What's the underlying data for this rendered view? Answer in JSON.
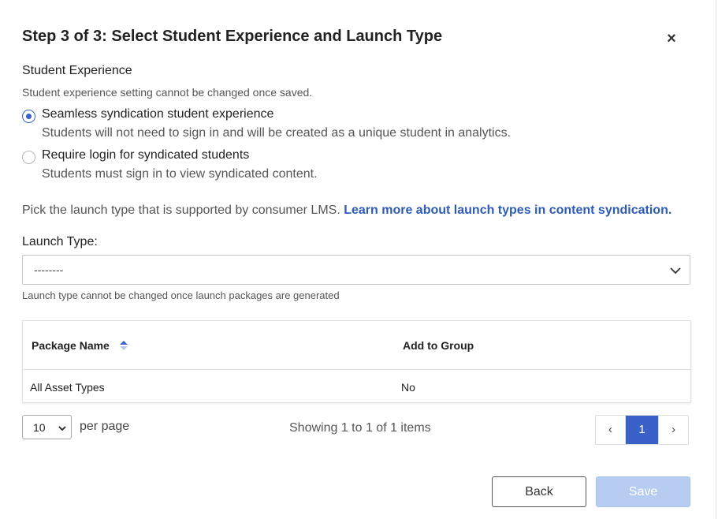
{
  "dialog": {
    "title": "Step 3 of 3: Select Student Experience and Launch Type",
    "close_label": "×"
  },
  "student_experience": {
    "heading": "Student Experience",
    "note": "Student experience setting cannot be changed once saved.",
    "options": [
      {
        "label": "Seamless syndication student experience",
        "description": "Students will not need to sign in and will be created as a unique student in analytics.",
        "selected": true
      },
      {
        "label": "Require login for syndicated students",
        "description": "Students must sign in to view syndicated content.",
        "selected": false
      }
    ]
  },
  "launch": {
    "intro": "Pick the launch type that is supported by consumer LMS.",
    "learn_more_link": "Learn more about launch types in content syndication.",
    "label": "Launch Type:",
    "selected_value": "--------",
    "help": "Launch type cannot be changed once launch packages are generated"
  },
  "table": {
    "columns": [
      "Package Name",
      "Add to Group"
    ],
    "rows": [
      [
        "All Asset Types",
        "No"
      ]
    ]
  },
  "pagination": {
    "per_page_value": "10",
    "per_page_label": "per page",
    "showing_text": "Showing 1 to 1 of 1 items",
    "prev_label": "‹",
    "current_page": "1",
    "next_label": "›"
  },
  "footer": {
    "back_label": "Back",
    "save_label": "Save"
  },
  "colors": {
    "accent": "#3a61c8",
    "link": "#2d5bb9",
    "save_disabled_bg": "#b6cdf1"
  },
  "icons": {
    "close": "close-icon",
    "select_chevron": "chevron-down-icon",
    "sort": "sort-icon"
  }
}
